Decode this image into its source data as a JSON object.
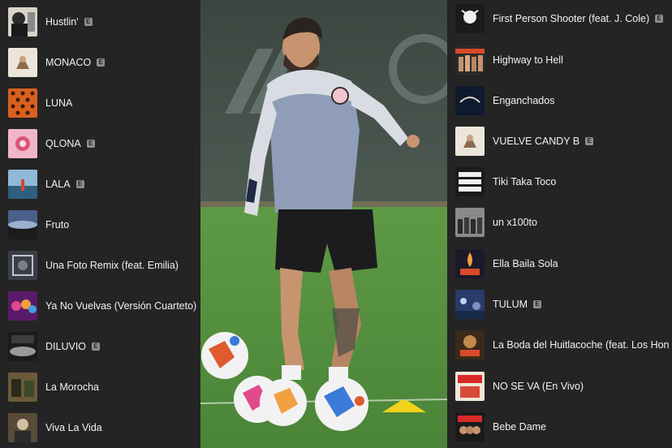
{
  "left_panel": {
    "tracks": [
      {
        "title": "Hustlin'",
        "explicit": true
      },
      {
        "title": "MONACO",
        "explicit": true
      },
      {
        "title": "LUNA",
        "explicit": false
      },
      {
        "title": "QLONA",
        "explicit": true
      },
      {
        "title": "LALA",
        "explicit": true
      },
      {
        "title": "Fruto",
        "explicit": false
      },
      {
        "title": "Una Foto Remix (feat. Emilia)",
        "explicit": false
      },
      {
        "title": "Ya No Vuelvas (Versión Cuarteto)",
        "explicit": false
      },
      {
        "title": "DILUVIO",
        "explicit": true
      },
      {
        "title": "La Morocha",
        "explicit": false
      },
      {
        "title": "Viva La Vida",
        "explicit": false
      }
    ]
  },
  "right_panel": {
    "tracks": [
      {
        "title": "First Person Shooter (feat. J. Cole)",
        "explicit": true
      },
      {
        "title": "Highway to Hell",
        "explicit": false
      },
      {
        "title": "Enganchados",
        "explicit": false
      },
      {
        "title": "VUELVE CANDY B",
        "explicit": true
      },
      {
        "title": "Tiki Taka Toco",
        "explicit": false
      },
      {
        "title": "un x100to",
        "explicit": false
      },
      {
        "title": "Ella Baila Sola",
        "explicit": false
      },
      {
        "title": "TULUM",
        "explicit": true
      },
      {
        "title": "La Boda del Huitlacoche (feat. Los Hon",
        "explicit": false
      },
      {
        "title": "NO SE VA (En Vivo)",
        "explicit": false
      },
      {
        "title": "Bebe Dame",
        "explicit": false
      }
    ]
  },
  "badge_text": "E",
  "colors": {
    "panel_bg": "#242424",
    "text": "#f2f2f2",
    "badge": "#8e8e8e",
    "grass": "#4c8a3a"
  }
}
